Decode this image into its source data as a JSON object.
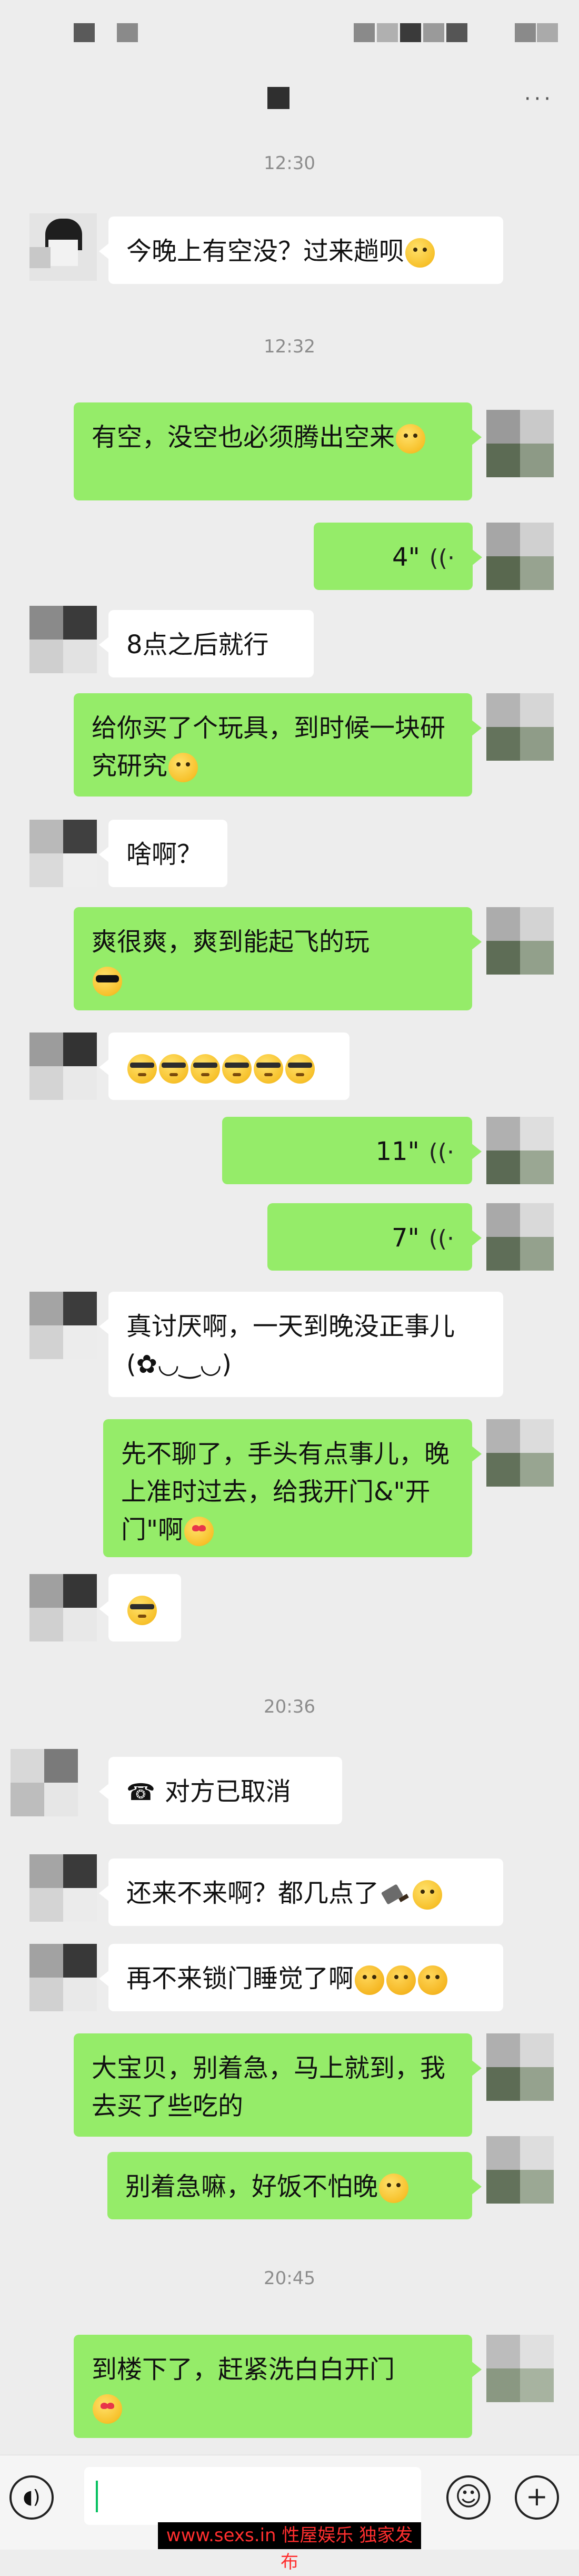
{
  "status_bar": {},
  "header": {
    "more": "···"
  },
  "timestamps": [
    "12:30",
    "12:32",
    "20:36",
    "20:45"
  ],
  "messages": [
    {
      "side": "left",
      "text": "今晚上有空没？过来趟呗"
    },
    {
      "side": "right",
      "text": "有空，没空也必须腾出空来"
    },
    {
      "side": "right",
      "voice": "4\""
    },
    {
      "side": "left",
      "text": "8点之后就行"
    },
    {
      "side": "right",
      "text": "给你买了个玩具，到时候一块研究研究"
    },
    {
      "side": "left",
      "text": "啥啊？"
    },
    {
      "side": "right",
      "text": "爽很爽，爽到能起飞的玩"
    },
    {
      "side": "left",
      "text": ""
    },
    {
      "side": "right",
      "voice": "11\""
    },
    {
      "side": "right",
      "voice": "7\""
    },
    {
      "side": "left",
      "text": "真讨厌啊，一天到晚没正事儿(✿◡‿◡)"
    },
    {
      "side": "right",
      "text": "先不聊了，手头有点事儿，晚上准时过去，给我开门&\"开门\"啊"
    },
    {
      "side": "left",
      "text": ""
    },
    {
      "side": "left",
      "call": "对方已取消"
    },
    {
      "side": "left",
      "text": "还来不来啊？都几点了"
    },
    {
      "side": "left",
      "text": "再不来锁门睡觉了啊"
    },
    {
      "side": "right",
      "text": "大宝贝，别着急，马上就到，我去买了些吃的"
    },
    {
      "side": "right",
      "text": "别着急嘛，好饭不怕晚"
    },
    {
      "side": "right",
      "text": "到楼下了，赶紧洗白白开门"
    }
  ],
  "call_icon": "phone-hangup-icon",
  "input_bar": {
    "voice_icon": "voice-icon",
    "emoji_icon": "emoji-icon",
    "plus_icon": "plus-icon"
  },
  "watermark": "www.sexs.in 性屋娱乐 独家发布",
  "colors": {
    "background": "#ededed",
    "bubble_self": "#95ec69",
    "bubble_other": "#ffffff",
    "timestamp": "#8c8c8c"
  }
}
